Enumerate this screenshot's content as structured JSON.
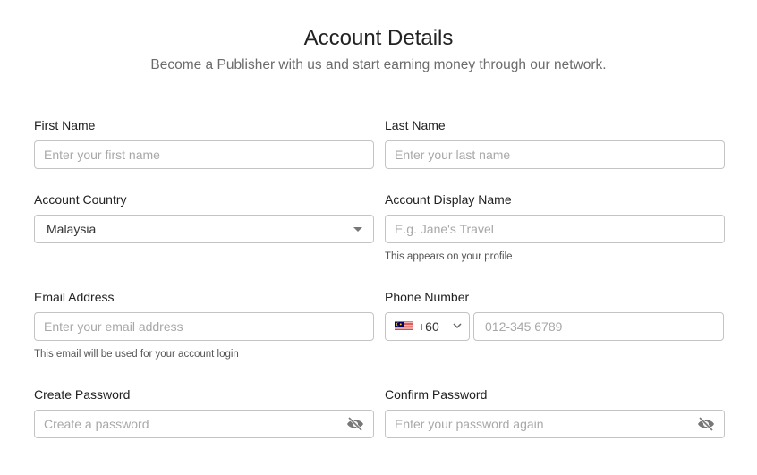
{
  "header": {
    "title": "Account Details",
    "subtitle": "Become a Publisher with us and start earning money through our network."
  },
  "fields": {
    "first_name": {
      "label": "First Name",
      "placeholder": "Enter your first name"
    },
    "last_name": {
      "label": "Last Name",
      "placeholder": "Enter your last name"
    },
    "country": {
      "label": "Account Country",
      "value": "Malaysia",
      "icon": "caret-down-icon"
    },
    "display_name": {
      "label": "Account Display Name",
      "placeholder": "E.g. Jane's Travel",
      "help": "This appears on your profile"
    },
    "email": {
      "label": "Email Address",
      "placeholder": "Enter your email address",
      "help": "This email will be used for your account login"
    },
    "phone": {
      "label": "Phone Number",
      "country_code": "+60",
      "flag": "malaysia-flag-icon",
      "placeholder": "012-345 6789"
    },
    "password": {
      "label": "Create Password",
      "placeholder": "Create a password",
      "icon": "eye-slash-icon"
    },
    "confirm_password": {
      "label": "Confirm Password",
      "placeholder": "Enter your password again",
      "icon": "eye-slash-icon"
    }
  },
  "colors": {
    "border": "#c4c4c4",
    "placeholder": "#a8a8a8",
    "label": "#212121"
  }
}
